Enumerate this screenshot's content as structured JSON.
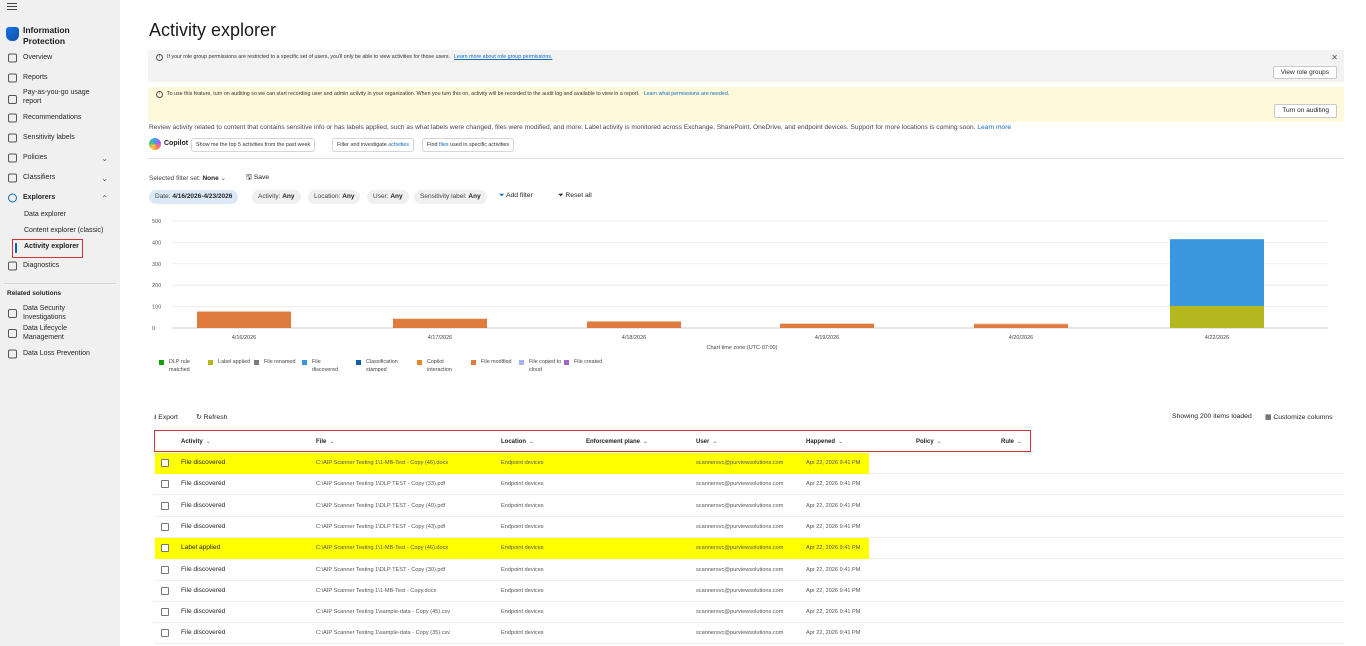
{
  "sidebar": {
    "app_title": "Information Protection",
    "items": [
      {
        "label": "Overview",
        "icon": "overview-icon"
      },
      {
        "label": "Reports",
        "icon": "reports-icon"
      },
      {
        "label": "Pay-as-you-go usage report",
        "icon": "payg-icon"
      },
      {
        "label": "Recommendations",
        "icon": "recommendations-icon"
      },
      {
        "label": "Sensitivity labels",
        "icon": "labels-icon"
      },
      {
        "label": "Policies",
        "icon": "policies-icon"
      },
      {
        "label": "Classifiers",
        "icon": "classifiers-icon"
      },
      {
        "label": "Explorers",
        "icon": "explorers-icon"
      },
      {
        "label": "Diagnostics",
        "icon": "diagnostics-icon"
      }
    ],
    "explorer_subitems": [
      "Data explorer",
      "Content explorer (classic)",
      "Activity explorer"
    ],
    "related_title": "Related solutions",
    "related": [
      "Data Security Investigations",
      "Data Lifecycle Management",
      "Data Loss Prevention"
    ]
  },
  "page": {
    "title": "Activity explorer",
    "info_banner": {
      "text": "If your role group permissions are restricted to a specific set of users, you'll only be able to view activities for those users.",
      "link": "Learn more about role group permissions.",
      "button": "View role groups"
    },
    "warn_banner": {
      "text": "To use this feature, turn on auditing so we can start recording user and admin activity in your organization. When you turn this on, activity will be recorded to the audit log and available to view in a report.",
      "link": "Learn what permissions are needed.",
      "button": "Turn on auditing"
    },
    "intro": "Review activity related to content that contains sensitive info or has labels applied, such as what labels were changed, files were modified, and more. Label activity is monitored across Exchange, SharePoint, OneDrive, and endpoint devices. Support for more locations is coming soon.",
    "intro_link": "Learn more",
    "copilot": {
      "label": "Copilot",
      "chips": [
        {
          "pre": "Show me the top 5 activities from the past week",
          "hl": "",
          "post": ""
        },
        {
          "pre": "Filter and investigate ",
          "hl": "activities",
          "post": ""
        },
        {
          "pre": "Find ",
          "hl": "files",
          "post": " used in specific activities"
        }
      ]
    },
    "filters": {
      "set_label": "Selected filter set:",
      "set_value": "None",
      "save": "Save",
      "pills": [
        {
          "key": "Date:",
          "val": "4/16/2026-4/23/2026"
        },
        {
          "key": "Activity:",
          "val": "Any"
        },
        {
          "key": "Location:",
          "val": "Any"
        },
        {
          "key": "User:",
          "val": "Any"
        },
        {
          "key": "Sensitivity label:",
          "val": "Any"
        }
      ],
      "add_filter": "Add filter",
      "reset_all": "Reset all"
    }
  },
  "chart_data": {
    "type": "bar",
    "stacked": true,
    "categories": [
      "4/16/2026",
      "4/17/2026",
      "4/18/2026",
      "4/19/2026",
      "4/20/2026",
      "4/22/2026"
    ],
    "series": [
      {
        "name": "Label applied",
        "color": "#b5b71e",
        "values": [
          0,
          0,
          0,
          0,
          0,
          103
        ]
      },
      {
        "name": "File discovered",
        "color": "#3a96dd",
        "values": [
          0,
          0,
          0,
          0,
          0,
          312
        ]
      },
      {
        "name": "File modified",
        "color": "#e07b3f",
        "values": [
          75,
          42,
          30,
          20,
          18,
          0
        ]
      },
      {
        "name": "File renamed",
        "color": "#e8c7a8",
        "values": [
          5,
          3,
          2,
          2,
          3,
          0
        ]
      }
    ],
    "ylim": [
      0,
      500
    ],
    "yticks": [
      0,
      100,
      200,
      300,
      400,
      500
    ],
    "xlabel": "Chart time zone:(UTC-07:00)",
    "legend": [
      {
        "label": "DLP rule matched",
        "color": "#13a10e"
      },
      {
        "label": "Label applied",
        "color": "#b5b71e"
      },
      {
        "label": "File renamed",
        "color": "#7a7a7a"
      },
      {
        "label": "File discovered",
        "color": "#3a96dd"
      },
      {
        "label": "Classification stamped",
        "color": "#0f5fa8"
      },
      {
        "label": "Copilot interaction",
        "color": "#e8872a"
      },
      {
        "label": "File modified",
        "color": "#e07b3f"
      },
      {
        "label": "File copied to cloud",
        "color": "#a5b4f0"
      },
      {
        "label": "File created",
        "color": "#a162d1"
      }
    ],
    "legend_placement": "bottom",
    "grid": true
  },
  "table": {
    "export": "Export",
    "refresh": "Refresh",
    "showing": "Showing 200 items loaded",
    "customize": "Customize columns",
    "columns": [
      "Activity",
      "File",
      "Location",
      "Enforcement plane",
      "User",
      "Happened",
      "Policy",
      "Rule"
    ],
    "rows": [
      {
        "activity": "File discovered",
        "file": "C:\\AIP Scanner Testing 1\\1-MB-Test - Copy (46).docx",
        "location": "Endpoint devices",
        "user": "scannersvc@purviewsolutions.com",
        "happened": "Apr 22, 2026 9:41 PM",
        "highlight": true
      },
      {
        "activity": "File discovered",
        "file": "C:\\AIP Scanner Testing 1\\DLP TEST - Copy (33).pdf",
        "location": "Endpoint devices",
        "user": "scannersvc@purviewsolutions.com",
        "happened": "Apr 22, 2026 9:41 PM",
        "highlight": false
      },
      {
        "activity": "File discovered",
        "file": "C:\\AIP Scanner Testing 1\\DLP TEST - Copy (40).pdf",
        "location": "Endpoint devices",
        "user": "scannersvc@purviewsolutions.com",
        "happened": "Apr 22, 2026 9:41 PM",
        "highlight": false
      },
      {
        "activity": "File discovered",
        "file": "C:\\AIP Scanner Testing 1\\DLP TEST - Copy (43).pdf",
        "location": "Endpoint devices",
        "user": "scannersvc@purviewsolutions.com",
        "happened": "Apr 22, 2026 9:41 PM",
        "highlight": false
      },
      {
        "activity": "Label applied",
        "file": "C:\\AIP Scanner Testing 1\\1-MB-Test - Copy (46).docx",
        "location": "Endpoint devices",
        "user": "scannersvc@purviewsolutions.com",
        "happened": "Apr 22, 2026 9:41 PM",
        "highlight": true
      },
      {
        "activity": "File discovered",
        "file": "C:\\AIP Scanner Testing 1\\DLP TEST - Copy (30).pdf",
        "location": "Endpoint devices",
        "user": "scannersvc@purviewsolutions.com",
        "happened": "Apr 22, 2026 9:41 PM",
        "highlight": false
      },
      {
        "activity": "File discovered",
        "file": "C:\\AIP Scanner Testing 1\\1-MB-Test - Copy.docx",
        "location": "Endpoint devices",
        "user": "scannersvc@purviewsolutions.com",
        "happened": "Apr 22, 2026 9:41 PM",
        "highlight": false
      },
      {
        "activity": "File discovered",
        "file": "C:\\AIP Scanner Testing 1\\sample-data - Copy (45).csv",
        "location": "Endpoint devices",
        "user": "scannersvc@purviewsolutions.com",
        "happened": "Apr 22, 2026 9:41 PM",
        "highlight": false
      },
      {
        "activity": "File discovered",
        "file": "C:\\AIP Scanner Testing 1\\sample-data - Copy (35).csv",
        "location": "Endpoint devices",
        "user": "scannersvc@purviewsolutions.com",
        "happened": "Apr 22, 2026 9:41 PM",
        "highlight": false
      }
    ]
  }
}
